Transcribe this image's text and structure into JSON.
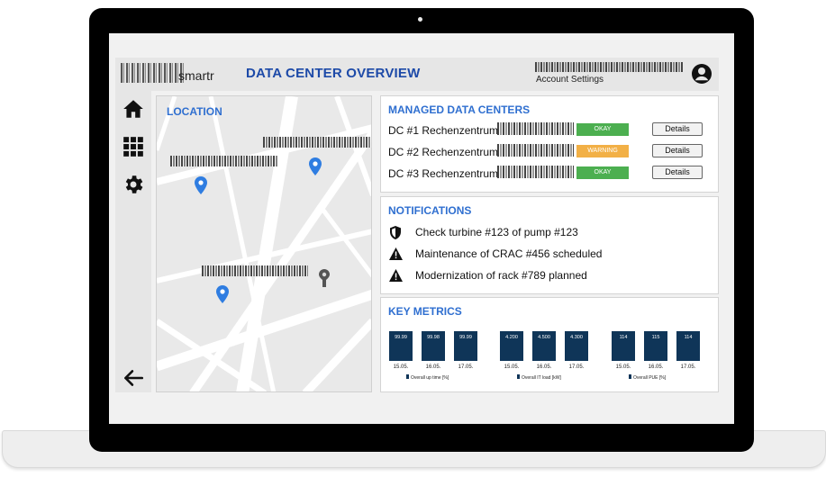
{
  "header": {
    "logo_text": "smartr",
    "title": "DATA CENTER OVERVIEW",
    "account_link": "Account Settings"
  },
  "sidebar": {
    "items": [
      {
        "icon": "home-icon"
      },
      {
        "icon": "grid-icon"
      },
      {
        "icon": "gear-icon"
      },
      {
        "icon": "back-arrow-icon"
      }
    ]
  },
  "location": {
    "title": "LOCATION"
  },
  "managed": {
    "title": "MANAGED DATA CENTERS",
    "rows": [
      {
        "name": "DC #1 Rechenzentrum",
        "status": "OKAY",
        "status_color": "#4caf50",
        "button": "Details"
      },
      {
        "name": "DC #2 Rechenzentrum",
        "status": "WARNING",
        "status_color": "#f2b046",
        "button": "Details"
      },
      {
        "name": "DC #3 Rechenzentrum",
        "status": "OKAY",
        "status_color": "#4caf50",
        "button": "Details"
      }
    ]
  },
  "notifications": {
    "title": "NOTIFICATIONS",
    "items": [
      {
        "icon": "shield-icon",
        "text": "Check turbine #123 of pump #123"
      },
      {
        "icon": "warning-icon",
        "text": "Maintenance of CRAC #456 scheduled"
      },
      {
        "icon": "warning-icon",
        "text": "Modernization of rack #789 planned"
      }
    ]
  },
  "metrics": {
    "title": "KEY METRICS"
  },
  "chart_data": [
    {
      "type": "bar",
      "categories": [
        "15.05.",
        "16.05.",
        "17.05."
      ],
      "values": [
        "99.99",
        "99.98",
        "99.99"
      ],
      "legend": "Overall up time [%]",
      "color": "#0f3558"
    },
    {
      "type": "bar",
      "categories": [
        "15.05.",
        "16.05.",
        "17.05."
      ],
      "values": [
        "4.200",
        "4.500",
        "4.300"
      ],
      "legend": "Overall IT load [kW]",
      "color": "#0f3558"
    },
    {
      "type": "bar",
      "categories": [
        "15.05.",
        "16.05.",
        "17.05."
      ],
      "values": [
        "114",
        "115",
        "114"
      ],
      "legend": "Overall PUE [%]",
      "color": "#0f3558"
    }
  ],
  "colors": {
    "accent": "#2f6fd0",
    "title": "#1d4aa8",
    "bezel": "#000000",
    "bar": "#0f3558"
  }
}
